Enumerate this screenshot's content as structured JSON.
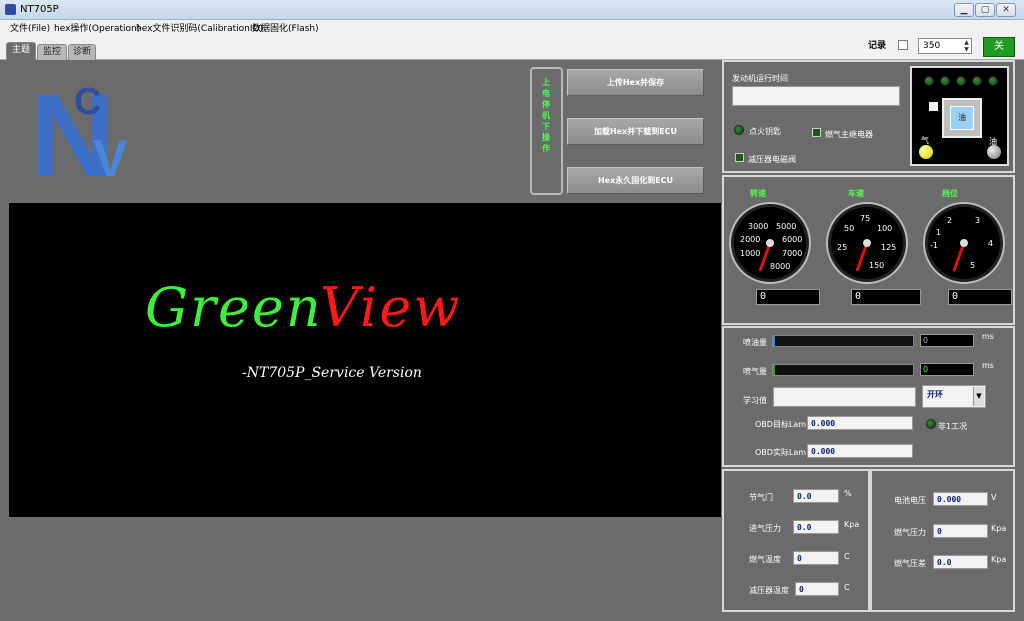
{
  "window": {
    "title": "NT705P",
    "min": "▁",
    "max": "▢",
    "close": "✕"
  },
  "menu": [
    "文件(File)",
    "hex操作(Operation)",
    "hex文件识别码(CalibrationID)",
    "数据固化(Flash)"
  ],
  "tabs": [
    "主题",
    "监控",
    "诊断"
  ],
  "record": {
    "label": "记录",
    "value": "350",
    "off_label": "关"
  },
  "logo": {
    "letters": [
      "N",
      "C",
      "V"
    ]
  },
  "buttons": {
    "upload": "上传Hex并保存",
    "load": "加载Hex并下载到ECU",
    "flash": "Hex永久固化到ECU"
  },
  "vertical_label": "上电停机下操作",
  "splash": {
    "green": "Green",
    "red": "View",
    "subtitle": "-NT705P_Service Version"
  },
  "engine": {
    "runtime_label": "发动机运行时间",
    "runtime_value": "",
    "ignition_label": "点火钥匙",
    "gas_relay_label": "燃气主继电器",
    "reducer_valve_label": "减压器电磁阀",
    "gas_label": "气",
    "oil_label": "油",
    "fuel_button_label": "油"
  },
  "gauges": [
    {
      "title": "转速",
      "ticks": [
        "3000",
        "5000",
        "2000",
        "6000",
        "1000",
        "7000",
        "8000"
      ],
      "value": "0"
    },
    {
      "title": "车速",
      "ticks": [
        "75",
        "50",
        "100",
        "25",
        "125",
        "150"
      ],
      "value": "0"
    },
    {
      "title": "档位",
      "ticks": [
        "2",
        "3",
        "1",
        "4",
        "-1",
        "5"
      ],
      "value": "0"
    }
  ],
  "injection": {
    "inject_oil_label": "喷油量",
    "inject_oil_value": "0",
    "inject_oil_unit": "ms",
    "inject_gas_label": "喷气量",
    "inject_gas_value": "0",
    "inject_gas_unit": "ms",
    "learn_label": "学习值",
    "learn_value": "",
    "loop_select": "开环",
    "obd_target_label": "OBD目标Lam",
    "obd_target_value": "0.000",
    "obd_actual_label": "OBD实际Lam",
    "obd_actual_value": "0.000",
    "condition_label": "非1工况"
  },
  "sensors_left": [
    {
      "label": "节气门",
      "value": "0.0",
      "unit": "%"
    },
    {
      "label": "进气压力",
      "value": "0.0",
      "unit": "Kpa"
    },
    {
      "label": "燃气温度",
      "value": "0",
      "unit": "C"
    },
    {
      "label": "减压器温度",
      "value": "0",
      "unit": "C"
    }
  ],
  "sensors_right": [
    {
      "label": "电池电压",
      "value": "0.000",
      "unit": "V"
    },
    {
      "label": "燃气压力",
      "value": "0",
      "unit": "Kpa"
    },
    {
      "label": "燃气压差",
      "value": "0.0",
      "unit": "Kpa"
    }
  ]
}
